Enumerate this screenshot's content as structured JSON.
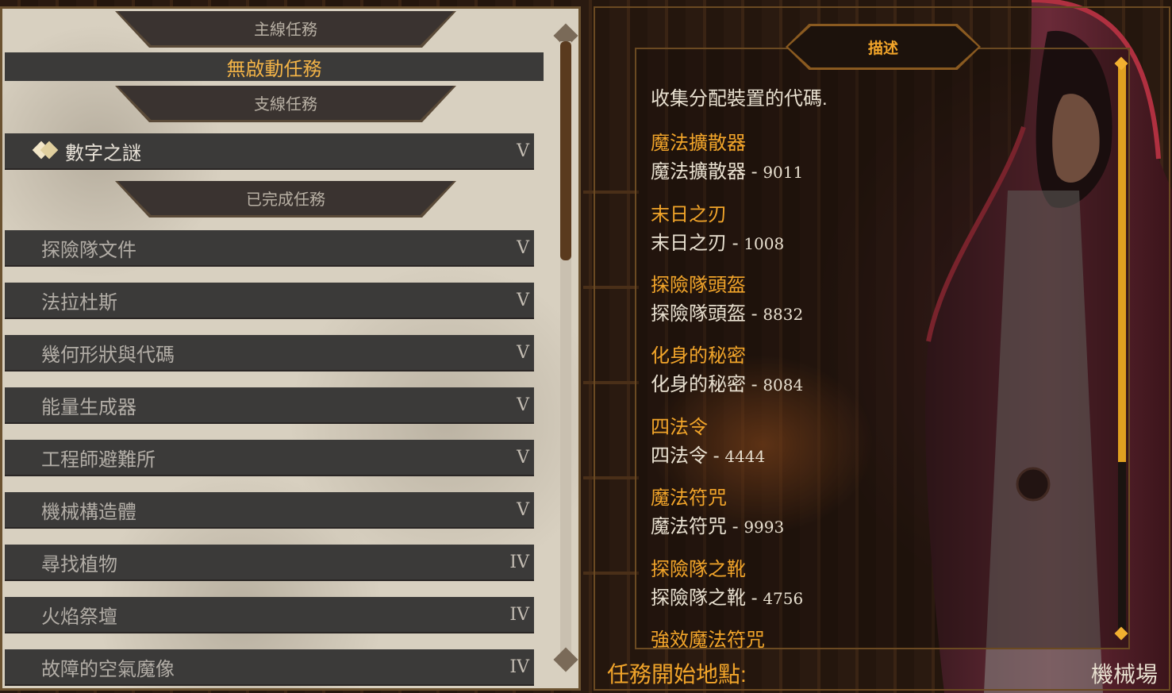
{
  "quest_list": {
    "main_header": "主線任務",
    "active_quest": "無啟動任務",
    "side_header": "支線任務",
    "side_quests": [
      {
        "name": "數字之謎",
        "level": "V"
      }
    ],
    "completed_header": "已完成任務",
    "completed_quests": [
      {
        "name": "探險隊文件",
        "level": "V"
      },
      {
        "name": "法拉杜斯",
        "level": "V"
      },
      {
        "name": "幾何形狀與代碼",
        "level": "V"
      },
      {
        "name": "能量生成器",
        "level": "V"
      },
      {
        "name": "工程師避難所",
        "level": "V"
      },
      {
        "name": "機械構造體",
        "level": "V"
      },
      {
        "name": "尋找植物",
        "level": "IV"
      },
      {
        "name": "火焰祭壇",
        "level": "IV"
      },
      {
        "name": "故障的空氣魔像",
        "level": "IV"
      }
    ]
  },
  "description": {
    "tab_label": "描述",
    "intro": "收集分配裝置的代碼.",
    "items": [
      {
        "title": "魔法擴散器",
        "name": "魔法擴散器",
        "code": "9011"
      },
      {
        "title": "末日之刃",
        "name": "末日之刃",
        "code": "1008"
      },
      {
        "title": "探險隊頭盔",
        "name": "探險隊頭盔",
        "code": "8832"
      },
      {
        "title": "化身的秘密",
        "name": "化身的秘密",
        "code": "8084"
      },
      {
        "title": "四法令",
        "name": "四法令",
        "code": "4444"
      },
      {
        "title": "魔法符咒",
        "name": "魔法符咒",
        "code": "9993"
      },
      {
        "title": "探險隊之靴",
        "name": "探險隊之靴",
        "code": "4756"
      }
    ],
    "partial_item_title": "強效魔法符咒"
  },
  "footer": {
    "start_label": "任務開始地點:",
    "start_value": "機械場"
  },
  "colors": {
    "accent_orange": "#f2a52a",
    "active_gold": "#f2b347",
    "row_bg": "#3b3a39",
    "parchment": "#d8d0c0"
  }
}
